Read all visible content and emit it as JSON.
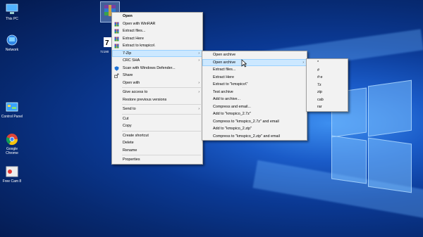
{
  "desktop": {
    "icons": [
      {
        "label": "This PC",
        "icon": "this-pc-icon"
      },
      {
        "label": "Network",
        "icon": "network-icon"
      },
      {
        "label": "Control Panel",
        "icon": "control-panel-icon"
      },
      {
        "label": "Google Chrome",
        "icon": "chrome-icon"
      },
      {
        "label": "Free Cam 8",
        "icon": "free-cam-icon"
      }
    ],
    "file_label": "7z190"
  },
  "context_menu": {
    "items": [
      {
        "label": "Open",
        "bold": true
      },
      {
        "label": "Open with WinRAR",
        "icon": "winrar-icon"
      },
      {
        "label": "Extract files...",
        "icon": "winrar-icon"
      },
      {
        "label": "Extract Here",
        "icon": "winrar-icon"
      },
      {
        "label": "Extract to kmspico\\",
        "icon": "winrar-icon"
      },
      {
        "label": "7-Zip",
        "submenu": true,
        "highlighted": true
      },
      {
        "label": "CRC SHA",
        "submenu": true
      },
      {
        "label": "Scan with Windows Defender...",
        "icon": "defender-icon"
      },
      {
        "label": "Share",
        "icon": "share-icon"
      },
      {
        "label": "Open with",
        "submenu": true
      },
      {
        "separator": true
      },
      {
        "label": "Give access to",
        "submenu": true
      },
      {
        "label": "Restore previous versions"
      },
      {
        "separator": true
      },
      {
        "label": "Send to",
        "submenu": true
      },
      {
        "separator": true
      },
      {
        "label": "Cut"
      },
      {
        "label": "Copy"
      },
      {
        "separator": true
      },
      {
        "label": "Create shortcut"
      },
      {
        "label": "Delete"
      },
      {
        "label": "Rename"
      },
      {
        "separator": true
      },
      {
        "label": "Properties"
      }
    ]
  },
  "zip_submenu": {
    "items": [
      {
        "label": "Open archive"
      },
      {
        "label": "Open archive",
        "submenu": true,
        "highlighted": true
      },
      {
        "label": "Extract files..."
      },
      {
        "label": "Extract Here"
      },
      {
        "label": "Extract to \"kmspico\\\""
      },
      {
        "label": "Test archive"
      },
      {
        "label": "Add to archive..."
      },
      {
        "label": "Compress and email..."
      },
      {
        "label": "Add to \"kmspico_2.7z\""
      },
      {
        "label": "Compress to \"kmspico_2.7z\" and email"
      },
      {
        "label": "Add to \"kmspico_2.zip\""
      },
      {
        "label": "Compress to \"kmspico_2.zip\" and email"
      }
    ]
  },
  "open_archive_submenu": {
    "items": [
      "*",
      "#",
      "#:e",
      "7z",
      "zip",
      "cab",
      "rar"
    ]
  },
  "colors": {
    "menu_bg": "#f2f2f2",
    "highlight": "#cce8ff",
    "accent": "#1a5bc8"
  }
}
